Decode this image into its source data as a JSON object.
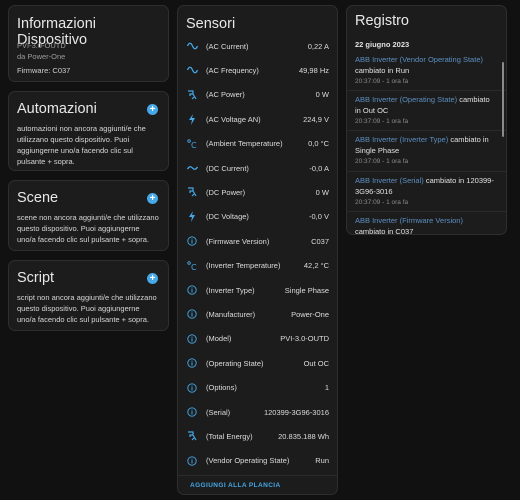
{
  "device_info": {
    "title": "Informazioni Dispositivo",
    "model": "PVI-3.0-OUTD",
    "manufacturer_line": "da Power-One",
    "firmware": "Firmware: C037"
  },
  "automations": {
    "title": "Automazioni",
    "text": "automazioni non ancora aggiunti/e che utilizzano questo dispositivo. Puoi aggiungerne uno/a facendo clic sul pulsante + sopra."
  },
  "scenes": {
    "title": "Scene",
    "text": "scene non ancora aggiunti/e che utilizzano questo dispositivo. Puoi aggiungerne uno/a facendo clic sul pulsante + sopra."
  },
  "scripts": {
    "title": "Script",
    "text": "script non ancora aggiunti/e che utilizzano questo dispositivo. Puoi aggiungerne uno/a facendo clic sul pulsante + sopra."
  },
  "sensors": {
    "title": "Sensori",
    "add_to_dashboard": "AGGIUNGI ALLA PLANCIA",
    "items": [
      {
        "icon": "sine-wave-icon",
        "name": "(AC Current)",
        "value": "0,22 A"
      },
      {
        "icon": "sine-wave-icon",
        "name": "(AC Frequency)",
        "value": "49,98 Hz"
      },
      {
        "icon": "power-plug-icon",
        "name": "(AC Power)",
        "value": "0 W"
      },
      {
        "icon": "lightning-icon",
        "name": "(AC Voltage AN)",
        "value": "224,9 V"
      },
      {
        "icon": "thermometer-icon",
        "name": "(Ambient Temperature)",
        "value": "0,0 °C"
      },
      {
        "icon": "tilde-icon",
        "name": "(DC Current)",
        "value": "-0,0 A"
      },
      {
        "icon": "power-plug-icon",
        "name": "(DC Power)",
        "value": "0 W"
      },
      {
        "icon": "lightning-icon",
        "name": "(DC Voltage)",
        "value": "-0,0 V"
      },
      {
        "icon": "info-icon",
        "name": "(Firmware Version)",
        "value": "C037"
      },
      {
        "icon": "thermometer-icon",
        "name": "(Inverter Temperature)",
        "value": "42,2 °C"
      },
      {
        "icon": "info-icon",
        "name": "(Inverter Type)",
        "value": "Single Phase"
      },
      {
        "icon": "info-icon",
        "name": "(Manufacturer)",
        "value": "Power-One"
      },
      {
        "icon": "info-icon",
        "name": "(Model)",
        "value": "PVI-3.0-OUTD"
      },
      {
        "icon": "info-icon",
        "name": "(Operating State)",
        "value": "Out OC"
      },
      {
        "icon": "info-icon",
        "name": "(Options)",
        "value": "1"
      },
      {
        "icon": "info-icon",
        "name": "(Serial)",
        "value": "120399-3G96-3016"
      },
      {
        "icon": "power-plug-icon",
        "name": "(Total Energy)",
        "value": "20.835.188 Wh"
      },
      {
        "icon": "info-icon",
        "name": "(Vendor Operating State)",
        "value": "Run"
      }
    ]
  },
  "logbook": {
    "title": "Registro",
    "date": "22 giugno 2023",
    "entries": [
      {
        "entity": "ABB Inverter (Vendor Operating State)",
        "message": "cambiato in Run",
        "time": "20:37:09 - 1 ora fa"
      },
      {
        "entity": "ABB Inverter (Operating State)",
        "message": "cambiato in Out OC",
        "time": "20:37:09 - 1 ora fa"
      },
      {
        "entity": "ABB Inverter (Inverter Type)",
        "message": "cambiato in Single Phase",
        "time": "20:37:09 - 1 ora fa"
      },
      {
        "entity": "ABB Inverter (Serial)",
        "message": "cambiato in 120399-3G96-3016",
        "time": "20:37:09 - 1 ora fa"
      },
      {
        "entity": "ABB Inverter (Firmware Version)",
        "message": "cambiato in C037",
        "time": ""
      }
    ]
  },
  "colors": {
    "accent": "#45a8e8",
    "link": "#5c8fc2",
    "background": "#111111",
    "card": "#1c1c1c"
  }
}
